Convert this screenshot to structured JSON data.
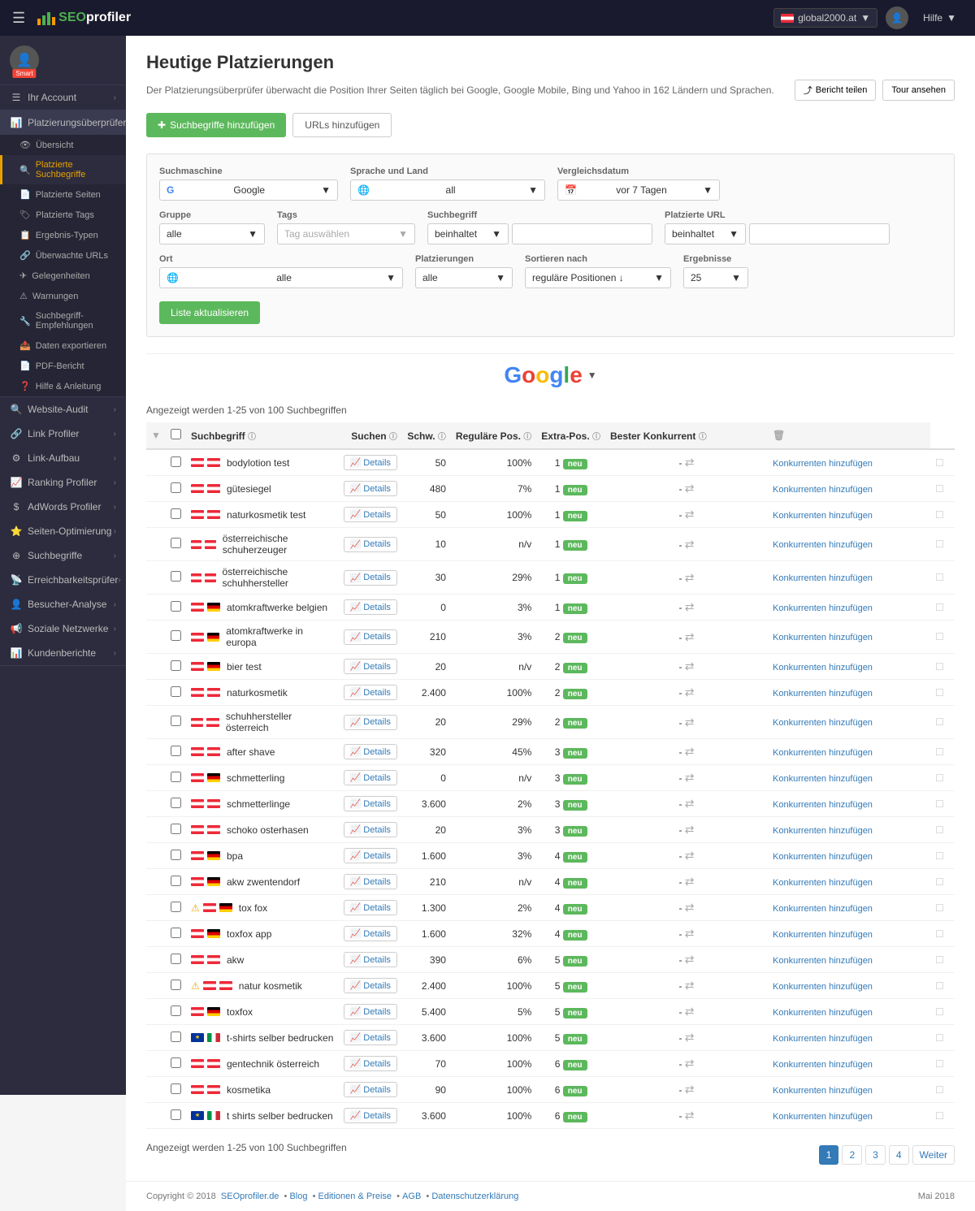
{
  "topnav": {
    "logo_text": "SEOprofiler",
    "hamburger": "☰",
    "site_selector": "global2000.at",
    "user_label": "blurred_user",
    "help_label": "Hilfe"
  },
  "sidebar": {
    "profile_name": "blurred",
    "smart_badge": "Smart",
    "items": [
      {
        "id": "ihr-account",
        "label": "Ihr Account",
        "icon": "☰",
        "has_chevron": true
      },
      {
        "id": "platzierungsuberprüfer",
        "label": "Platzierungsüberprüfer",
        "icon": "📊",
        "has_chevron": true,
        "active": true
      },
      {
        "id": "ubersicht",
        "label": "Übersicht",
        "icon": "👁",
        "sub": true
      },
      {
        "id": "platzierte-suchbegriffe",
        "label": "Platzierte Suchbegriffe",
        "icon": "🔍",
        "sub": true,
        "active": true
      },
      {
        "id": "platzierte-seiten",
        "label": "Platzierte Seiten",
        "icon": "📄",
        "sub": true
      },
      {
        "id": "platzierte-tags",
        "label": "Platzierte Tags",
        "icon": "🏷",
        "sub": true
      },
      {
        "id": "ergebnis-typen",
        "label": "Ergebnis-Typen",
        "icon": "📋",
        "sub": true
      },
      {
        "id": "uberwachte-urls",
        "label": "Überwachte URLs",
        "icon": "🔗",
        "sub": true
      },
      {
        "id": "gelegenheiten",
        "label": "Gelegenheiten",
        "icon": "✈",
        "sub": true
      },
      {
        "id": "warnungen",
        "label": "Warnungen",
        "icon": "⚠",
        "sub": true
      },
      {
        "id": "suchbegriff-empfehlungen",
        "label": "Suchbegriff-Empfehlungen",
        "icon": "🔧",
        "sub": true
      },
      {
        "id": "daten-exportieren",
        "label": "Daten exportieren",
        "icon": "📤",
        "sub": true
      },
      {
        "id": "pdf-bericht",
        "label": "PDF-Bericht",
        "icon": "📄",
        "sub": true
      },
      {
        "id": "hilfe-anleitung",
        "label": "Hilfe & Anleitung",
        "icon": "❓",
        "sub": true
      }
    ],
    "sections": [
      {
        "id": "website-audit",
        "label": "Website-Audit",
        "icon": "🔍",
        "has_chevron": true
      },
      {
        "id": "link-profiler",
        "label": "Link Profiler",
        "icon": "🔗",
        "has_chevron": true
      },
      {
        "id": "link-aufbau",
        "label": "Link-Aufbau",
        "icon": "⚙",
        "has_chevron": true
      },
      {
        "id": "ranking-profiler",
        "label": "Ranking Profiler",
        "icon": "📈",
        "has_chevron": true
      },
      {
        "id": "adwords-profiler",
        "label": "AdWords Profiler",
        "icon": "$",
        "has_chevron": true
      },
      {
        "id": "seiten-optimierung",
        "label": "Seiten-Optimierung",
        "icon": "⭐",
        "has_chevron": true
      },
      {
        "id": "suchbegriffe",
        "label": "Suchbegriffe",
        "icon": "⊕",
        "has_chevron": true
      },
      {
        "id": "erreichbarkeitsprufer",
        "label": "Erreichbarkeitsprüfer",
        "icon": "📡",
        "has_chevron": true
      },
      {
        "id": "besucher-analyse",
        "label": "Besucher-Analyse",
        "icon": "👤",
        "has_chevron": true
      },
      {
        "id": "soziale-netzwerke",
        "label": "Soziale Netzwerke",
        "icon": "📢",
        "has_chevron": true
      },
      {
        "id": "kundenberichte",
        "label": "Kundenberichte",
        "icon": "📊",
        "has_chevron": true
      }
    ]
  },
  "page": {
    "title": "Heutige Platzierungen",
    "description": "Der Platzierungsüberprüfer überwacht die Position Ihrer Seiten täglich bei Google, Google Mobile, Bing und Yahoo in 162 Ländern und Sprachen.",
    "btn_add_terms": "Suchbegriffe hinzufügen",
    "btn_add_urls": "URLs hinzufügen",
    "btn_share": "Bericht teilen",
    "btn_tour": "Tour ansehen"
  },
  "filters": {
    "suchmaschine_label": "Suchmaschine",
    "suchmaschine_value": "Google",
    "sprache_label": "Sprache und Land",
    "sprache_value": "all",
    "vergleichsdatum_label": "Vergleichsdatum",
    "vergleichsdatum_value": "vor 7 Tagen",
    "gruppe_label": "Gruppe",
    "gruppe_value": "alle",
    "tags_label": "Tags",
    "tags_placeholder": "Tag auswählen",
    "suchbegriff_label": "Suchbegriff",
    "suchbegriff_filter": "beinhaltet",
    "platzierte_url_label": "Platzierte URL",
    "platzierte_url_filter": "beinhaltet",
    "ort_label": "Ort",
    "ort_value": "alle",
    "platzierungen_label": "Platzierungen",
    "platzierungen_value": "alle",
    "sortieren_label": "Sortieren nach",
    "sortieren_value": "reguläre Positionen ↓",
    "ergebnisse_label": "Ergebnisse",
    "ergebnisse_value": "25",
    "btn_update": "Liste aktualisieren"
  },
  "google_section": {
    "logo": "Google",
    "dropdown_icon": "▼"
  },
  "table": {
    "results_text_top": "Angezeigt werden 1-25 von 100 Suchbegriffen",
    "results_text_bottom": "Angezeigt werden 1-25 von 100 Suchbegriffen",
    "col_suchbegriff": "Suchbegriff",
    "col_suchen": "Suchen",
    "col_schwierigkeit": "Schw.",
    "col_reg_pos": "Reguläre Pos.",
    "col_extra_pos": "Extra-Pos.",
    "col_best_konkurrent": "Bester Konkurrent",
    "rows": [
      {
        "term": "bodylotion test",
        "flag1": "at",
        "flag2": "at",
        "searches": "50",
        "schwierigkeit": "100%",
        "reg_pos": "1",
        "extra_pos": "-",
        "best_konkurrent": "Konkurrenten hinzufügen",
        "warn": false
      },
      {
        "term": "gütesiegel",
        "flag1": "at",
        "flag2": "at",
        "searches": "480",
        "schwierigkeit": "7%",
        "reg_pos": "1",
        "extra_pos": "-",
        "best_konkurrent": "Konkurrenten hinzufügen",
        "warn": false
      },
      {
        "term": "naturkosmetik test",
        "flag1": "at",
        "flag2": "at",
        "searches": "50",
        "schwierigkeit": "100%",
        "reg_pos": "1",
        "extra_pos": "-",
        "best_konkurrent": "Konkurrenten hinzufügen",
        "warn": false
      },
      {
        "term": "österreichische schuherzeuger",
        "flag1": "at",
        "flag2": "at",
        "searches": "10",
        "schwierigkeit": "n/v",
        "reg_pos": "1",
        "extra_pos": "-",
        "best_konkurrent": "Konkurrenten hinzufügen",
        "warn": false
      },
      {
        "term": "österreichische schuhhersteller",
        "flag1": "at",
        "flag2": "at",
        "searches": "30",
        "schwierigkeit": "29%",
        "reg_pos": "1",
        "extra_pos": "-",
        "best_konkurrent": "Konkurrenten hinzufügen",
        "warn": false
      },
      {
        "term": "atomkraftwerke belgien",
        "flag1": "at",
        "flag2": "de",
        "searches": "0",
        "schwierigkeit": "3%",
        "reg_pos": "1",
        "extra_pos": "-",
        "best_konkurrent": "Konkurrenten hinzufügen",
        "warn": false
      },
      {
        "term": "atomkraftwerke in europa",
        "flag1": "at",
        "flag2": "de",
        "searches": "210",
        "schwierigkeit": "3%",
        "reg_pos": "2",
        "extra_pos": "-",
        "best_konkurrent": "Konkurrenten hinzufügen",
        "warn": false
      },
      {
        "term": "bier test",
        "flag1": "at",
        "flag2": "de",
        "searches": "20",
        "schwierigkeit": "n/v",
        "reg_pos": "2",
        "extra_pos": "-",
        "best_konkurrent": "Konkurrenten hinzufügen",
        "warn": false
      },
      {
        "term": "naturkosmetik",
        "flag1": "at",
        "flag2": "at",
        "searches": "2.400",
        "schwierigkeit": "100%",
        "reg_pos": "2",
        "extra_pos": "-",
        "best_konkurrent": "Konkurrenten hinzufügen",
        "warn": false
      },
      {
        "term": "schuhhersteller österreich",
        "flag1": "at",
        "flag2": "at",
        "searches": "20",
        "schwierigkeit": "29%",
        "reg_pos": "2",
        "extra_pos": "-",
        "best_konkurrent": "Konkurrenten hinzufügen",
        "warn": false
      },
      {
        "term": "after shave",
        "flag1": "at",
        "flag2": "at",
        "searches": "320",
        "schwierigkeit": "45%",
        "reg_pos": "3",
        "extra_pos": "-",
        "best_konkurrent": "Konkurrenten hinzufügen",
        "warn": false
      },
      {
        "term": "schmetterling",
        "flag1": "at",
        "flag2": "de",
        "searches": "0",
        "schwierigkeit": "n/v",
        "reg_pos": "3",
        "extra_pos": "-",
        "best_konkurrent": "Konkurrenten hinzufügen",
        "warn": false
      },
      {
        "term": "schmetterlinge",
        "flag1": "at",
        "flag2": "at",
        "searches": "3.600",
        "schwierigkeit": "2%",
        "reg_pos": "3",
        "extra_pos": "-",
        "best_konkurrent": "Konkurrenten hinzufügen",
        "warn": false
      },
      {
        "term": "schoko osterhasen",
        "flag1": "at",
        "flag2": "at",
        "searches": "20",
        "schwierigkeit": "3%",
        "reg_pos": "3",
        "extra_pos": "-",
        "best_konkurrent": "Konkurrenten hinzufügen",
        "warn": false
      },
      {
        "term": "bpa",
        "flag1": "at",
        "flag2": "de",
        "searches": "1.600",
        "schwierigkeit": "3%",
        "reg_pos": "4",
        "extra_pos": "-",
        "best_konkurrent": "Konkurrenten hinzufügen",
        "warn": false
      },
      {
        "term": "akw zwentendorf",
        "flag1": "at",
        "flag2": "de",
        "searches": "210",
        "schwierigkeit": "n/v",
        "reg_pos": "4",
        "extra_pos": "-",
        "best_konkurrent": "Konkurrenten hinzufügen",
        "warn": false
      },
      {
        "term": "tox fox",
        "flag1": "at",
        "flag2": "de",
        "searches": "1.300",
        "schwierigkeit": "2%",
        "reg_pos": "4",
        "extra_pos": "-",
        "best_konkurrent": "Konkurrenten hinzufügen",
        "warn": true
      },
      {
        "term": "toxfox app",
        "flag1": "at",
        "flag2": "de",
        "searches": "1.600",
        "schwierigkeit": "32%",
        "reg_pos": "4",
        "extra_pos": "-",
        "best_konkurrent": "Konkurrenten hinzufügen",
        "warn": false
      },
      {
        "term": "akw",
        "flag1": "at",
        "flag2": "at",
        "searches": "390",
        "schwierigkeit": "6%",
        "reg_pos": "5",
        "extra_pos": "-",
        "best_konkurrent": "Konkurrenten hinzufügen",
        "warn": false
      },
      {
        "term": "natur kosmetik",
        "flag1": "at",
        "flag2": "at",
        "searches": "2.400",
        "schwierigkeit": "100%",
        "reg_pos": "5",
        "extra_pos": "-",
        "best_konkurrent": "Konkurrenten hinzufügen",
        "warn": true
      },
      {
        "term": "toxfox",
        "flag1": "at",
        "flag2": "de",
        "searches": "5.400",
        "schwierigkeit": "5%",
        "reg_pos": "5",
        "extra_pos": "-",
        "best_konkurrent": "Konkurrenten hinzufügen",
        "warn": false
      },
      {
        "term": "t-shirts selber bedrucken",
        "flag1": "eu",
        "flag2": "it",
        "searches": "3.600",
        "schwierigkeit": "100%",
        "reg_pos": "5",
        "extra_pos": "-",
        "best_konkurrent": "Konkurrenten hinzufügen",
        "warn": false
      },
      {
        "term": "gentechnik österreich",
        "flag1": "at",
        "flag2": "at",
        "searches": "70",
        "schwierigkeit": "100%",
        "reg_pos": "6",
        "extra_pos": "-",
        "best_konkurrent": "Konkurrenten hinzufügen",
        "warn": false
      },
      {
        "term": "kosmetika",
        "flag1": "at",
        "flag2": "at",
        "searches": "90",
        "schwierigkeit": "100%",
        "reg_pos": "6",
        "extra_pos": "-",
        "best_konkurrent": "Konkurrenten hinzufügen",
        "warn": false
      },
      {
        "term": "t shirts selber bedrucken",
        "flag1": "eu",
        "flag2": "it",
        "searches": "3.600",
        "schwierigkeit": "100%",
        "reg_pos": "6",
        "extra_pos": "-",
        "best_konkurrent": "Konkurrenten hinzufügen",
        "warn": false
      }
    ]
  },
  "pagination": {
    "current": 1,
    "pages": [
      "1",
      "2",
      "3",
      "4"
    ],
    "next_label": "Weiter"
  },
  "footer": {
    "copyright": "Copyright © 2018",
    "links": [
      {
        "label": "SEOprofiler.de",
        "url": "#"
      },
      {
        "label": "Blog",
        "url": "#"
      },
      {
        "label": "Editionen & Preise",
        "url": "#"
      },
      {
        "label": "AGB",
        "url": "#"
      },
      {
        "label": "Datenschutzerklärung",
        "url": "#"
      }
    ],
    "date": "Mai 2018"
  }
}
